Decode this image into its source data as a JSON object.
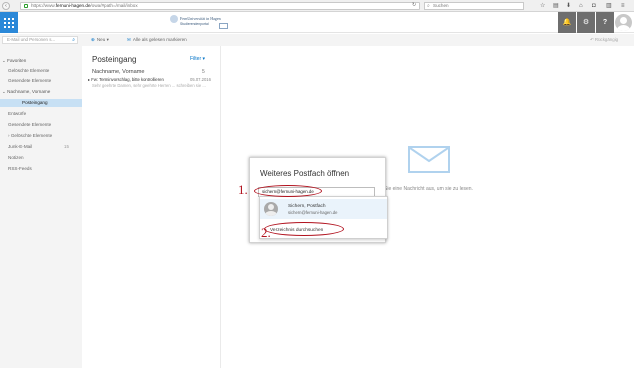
{
  "browser": {
    "url_prefix": "https://www.",
    "url_host": "fernuni-hagen.de",
    "url_path": "/owa/#path=/mail/inbox",
    "search_placeholder": "Suchen"
  },
  "header": {
    "logo_title": "FernUniversität in Hagen",
    "logo_subtitle": "Studierendenportal"
  },
  "commands": {
    "search_placeholder": "E-Mail und Personen s...",
    "new_label": "Neu",
    "mark_all_read": "Alle als gelesen markieren",
    "undo_label": "Rückgängig"
  },
  "folders": {
    "favorites": "Favoriten",
    "fav_deleted": "Gelöschte Elemente",
    "fav_sent": "Gesendete Elemente",
    "account": "Nachname, Vorname",
    "items": [
      {
        "label": "Posteingang"
      },
      {
        "label": "Entwürfe"
      },
      {
        "label": "Gesendete Elemente"
      },
      {
        "label": "Gelöschte Elemente"
      },
      {
        "label": "Junk-E-Mail",
        "count": "15"
      },
      {
        "label": "Notizen"
      },
      {
        "label": "RSS-Feeds"
      }
    ]
  },
  "message_list": {
    "title": "Posteingang",
    "filter": "Filter",
    "message": {
      "from": "Nachname, Vorname",
      "count": "5",
      "subject": "Fw: Terminvorschlag, bitte kontrollieren",
      "date": "05.07.2016",
      "preview": "Sehr geehrte Damen, sehr geehrte Herren ... schreiben sie ..."
    }
  },
  "reading_pane": {
    "hint": "Sie eine Nachricht aus, um sie zu lesen."
  },
  "dialog": {
    "title": "Weiteres Postfach öffnen",
    "input_value": "sichern@fernuni-hagen.de",
    "suggestion_name": "Sichern, Postfach",
    "suggestion_email": "sichern@fernuni-hagen.de",
    "directory_search": "Verzeichnis durchsuchen",
    "step1": "1.",
    "step2": "2."
  },
  "colors": {
    "accent": "#0072c6",
    "launcher": "#2b88d8",
    "header_buttons": "#6e6e6e",
    "annotation": "#b1121e",
    "selected_folder": "#c7e0f4"
  }
}
